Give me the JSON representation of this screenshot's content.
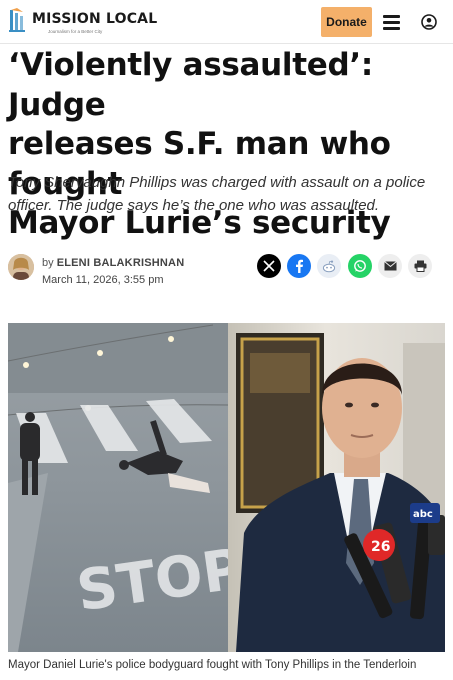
{
  "header": {
    "logo_text": "MISSION LOCAL",
    "logo_tagline": "Journalism for a Better City",
    "donate_label": "Donate"
  },
  "article": {
    "headline_line1": "‘Violently assaulted’: Judge",
    "headline_line2": "releases S.F. man who fought",
    "headline_line3": "Mayor Lurie’s security",
    "dek_line1": "Tony Shervaughn Phillips was charged with assault on a police",
    "dek_line2": "officer. The judge says he’s the one who was assaulted.",
    "byline_prefix": "by",
    "author": "ELENI BALAKRISHNAN",
    "date": "March 11, 2026, 3:55 pm"
  },
  "share_buttons": [
    {
      "name": "x",
      "color": "#000000"
    },
    {
      "name": "facebook",
      "color": "#1877f2"
    },
    {
      "name": "reddit",
      "color": "#e9eef5"
    },
    {
      "name": "whatsapp",
      "color": "#25d366"
    },
    {
      "name": "email",
      "color": "#eeeeee"
    },
    {
      "name": "print",
      "color": "#eeeeee"
    }
  ],
  "photo": {
    "stencil_text": "STOP",
    "mic_label_abc": "abc",
    "mic_label_26": "26"
  },
  "caption": "Mayor Daniel Lurie's police bodyguard fought with Tony Phillips in the Tenderloin",
  "colors": {
    "accent": "#f4b06a"
  }
}
